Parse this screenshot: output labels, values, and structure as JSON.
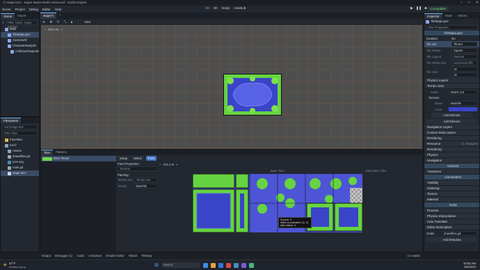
{
  "window": {
    "title": "(*) stage.tscn - Super Mario World Advanced - Godot Engine",
    "controls": [
      "–",
      "□",
      "✕"
    ]
  },
  "menu": [
    "Scene",
    "Project",
    "Debug",
    "Editor",
    "Help"
  ],
  "main_modes": [
    "2D",
    "3D",
    "Script",
    "AssetLib"
  ],
  "renderer": "Compatible",
  "scene_dock": {
    "tabs": [
      "Scene",
      "Import"
    ],
    "filter_placeholder": "Filter: name, t:type, g:group",
    "nodes": [
      "Main",
      "TileMapLayer",
      "Camera2D",
      "CharacterBody2D",
      "CollisionShape2D"
    ]
  },
  "filesystem": {
    "title": "FileSystem",
    "path": "res://stage.tscn",
    "filter_placeholder": "Filter Files",
    "items": [
      "Favorites:",
      "res://",
      "Assets",
      "drawsfiles.gd",
      "icon.svg",
      "main.gd",
      "stage.tscn"
    ]
  },
  "editor_tab": "stage(*)",
  "viewport": {
    "zoom": "479.1 %",
    "view_label": "View"
  },
  "bottom_panel": {
    "tabs": [
      "Tiles",
      "Patterns"
    ],
    "tileset_item": "Beta Tileset",
    "tools": [
      "Setup",
      "Select",
      "Paint"
    ],
    "paint_properties_label": "Paint Properties:",
    "paint_properties_value": "Terrains",
    "painting_label": "Painting:",
    "terrain_set_label": "Terrain Set",
    "terrain_set_value": "Terrain Set",
    "terrain_label": "Terrain",
    "terrain_value": "BetaTile",
    "zoom": "474.1 %",
    "base_tiles": "Base Tiles",
    "alt_tiles": "Alternative Tiles",
    "tooltip": [
      "Source: 0",
      "Atlas coordinates: (5, 2)",
      "Alternative: 0"
    ]
  },
  "inspector": {
    "tabs": [
      "Inspector",
      "Node",
      "History"
    ],
    "object": "TileMapLayer",
    "filter_placeholder": "Filter Properties",
    "class_name": "TileMapLayer",
    "enabled_label": "Enabled",
    "enabled_value": "On",
    "tile_set_label": "Tile Set",
    "tile_set_value": "TileSet",
    "tile_shape_label": "Tile Shape",
    "tile_shape_value": "Square",
    "tile_layout_label": "Tile Layout",
    "tile_layout_value": "Stacked",
    "tile_offset_label": "Tile Offset Axis",
    "tile_offset_value": "Horizontal Offs",
    "tile_size_label": "Tile Size",
    "tile_size_x": "16",
    "tile_size_y": "16",
    "sections": [
      "Physics Layers",
      "Terrain Sets"
    ],
    "mode_label": "Mode",
    "mode_value": "Match Cor",
    "terrains_label": "Terrains",
    "terrain_name_label": "Name",
    "terrain_name_value": "BetaTile",
    "terrain_color_label": "Color",
    "add_element": "Add Element",
    "more_sections": [
      "Navigation Layers",
      "Custom Data Layers",
      "Rendering",
      "Resource"
    ],
    "changes": "(1 changes)",
    "transform_header": "Transform",
    "node2d": "Node2D",
    "canvasitem": "CanvasItem",
    "canvas_subs": [
      "Visibility",
      "Ordering",
      "Texture",
      "Material"
    ],
    "node_header": "Node",
    "node_subs": [
      "Process",
      "Physics Interpolation",
      "Auto Translate",
      "Editor Description"
    ],
    "script_label": "Script",
    "script_value": "drawsfiles.gd",
    "add_metadata": "Add Metadata",
    "pre_sections": [
      "Rendering",
      "Physics",
      "Navigation"
    ],
    "node_class": "Node2D"
  },
  "bottom_tabs": [
    "Output",
    "Debugger (1)",
    "Audio",
    "Animation",
    "Shader Editor",
    "Tileset",
    "TileMap"
  ],
  "version": "4.3.stable",
  "taskbar": {
    "weather_temp": "67°F",
    "weather_desc": "Mostly sunny",
    "search_placeholder": "Search",
    "time": "10:52 AM",
    "date": "9/4/2024"
  },
  "colors": {
    "accent": "#70b8ff",
    "tile_green": "#6fd64a",
    "tile_blue": "#4d55d6"
  }
}
